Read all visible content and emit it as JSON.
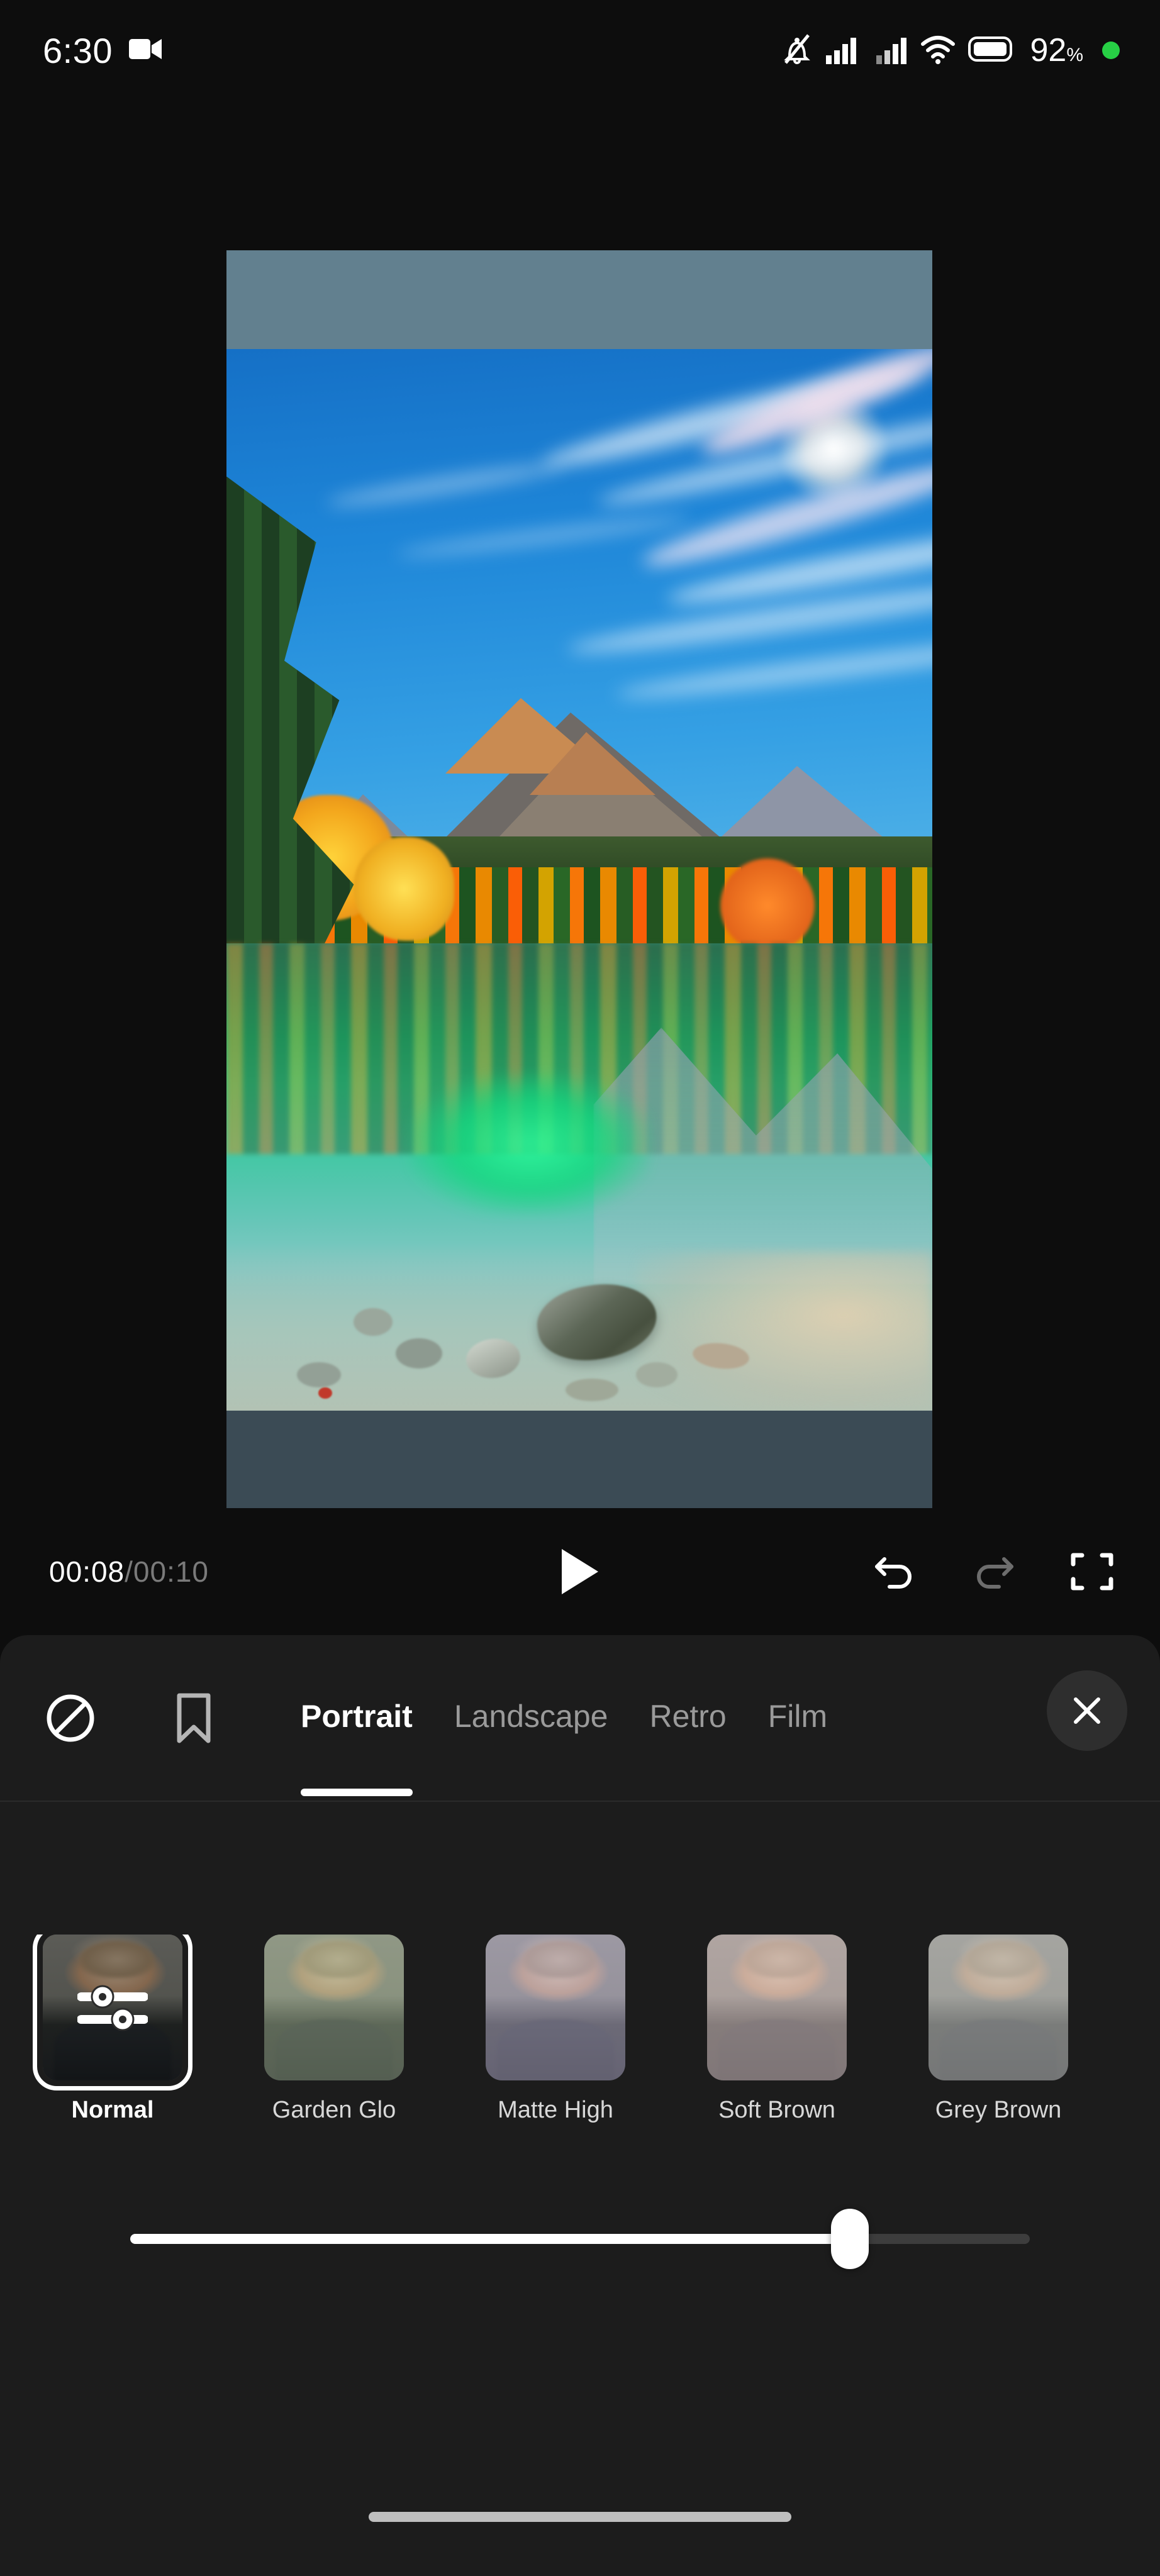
{
  "status_bar": {
    "time": "6:30",
    "battery_percent": "92",
    "percent_symbol": "%",
    "icons": [
      "video-recording-icon",
      "bell-muted-icon",
      "signal-bars-icon",
      "signal-bars-secondary-icon",
      "wifi-icon",
      "battery-icon",
      "status-dot-icon"
    ],
    "dot_color": "#27d045"
  },
  "player": {
    "current_time": "00:08",
    "total_time": "/00:10",
    "play_label": "play-icon",
    "undo_label": "undo-icon",
    "redo_label": "redo-icon",
    "fullscreen_label": "fullscreen-icon",
    "undo_enabled": "true",
    "redo_enabled": "false"
  },
  "panel": {
    "left_icons": [
      {
        "name": "no-filter-icon",
        "label": "None"
      },
      {
        "name": "bookmark-icon",
        "label": "Saved"
      }
    ],
    "tabs": [
      {
        "label": "Portrait",
        "active": "true"
      },
      {
        "label": "Landscape",
        "active": "false"
      },
      {
        "label": "Retro",
        "active": "false"
      },
      {
        "label": "Film",
        "active": "false"
      }
    ],
    "close_label": "close-icon",
    "filters": [
      {
        "name": "Normal",
        "truncated_label": "Normal",
        "selected": "true",
        "tint": "t-normal",
        "has_adjust_icon": "true"
      },
      {
        "name": "Garden Glow",
        "truncated_label": "Garden Glo",
        "selected": "false",
        "tint": "t-garden",
        "has_adjust_icon": "false"
      },
      {
        "name": "Matte Highlight",
        "truncated_label": "Matte High",
        "selected": "false",
        "tint": "t-matte",
        "has_adjust_icon": "false"
      },
      {
        "name": "Soft Brown",
        "truncated_label": "Soft Brown",
        "selected": "false",
        "tint": "t-soft",
        "has_adjust_icon": "false"
      },
      {
        "name": "Grey Brown",
        "truncated_label": "Grey Brown",
        "selected": "false",
        "tint": "t-grey",
        "has_adjust_icon": "false"
      }
    ],
    "intensity_slider": {
      "value_percent": 80,
      "min": 0,
      "max": 100
    }
  },
  "colors": {
    "page_background": "#0d0d0d",
    "panel_background": "#1c1c1c",
    "accent_white": "#ffffff",
    "inactive_text": "#9a9a9a",
    "letterbox_top": "#62808f",
    "letterbox_bottom": "#3b4b55"
  },
  "labels": {
    "l0": "Normal",
    "l1": "Garden Glo",
    "l2": "Matte High",
    "l3": "Soft Brown",
    "l4": "Grey Brown",
    "t0": "Portrait",
    "t1": "Landscape",
    "t2": "Retro",
    "t3": "Film"
  }
}
